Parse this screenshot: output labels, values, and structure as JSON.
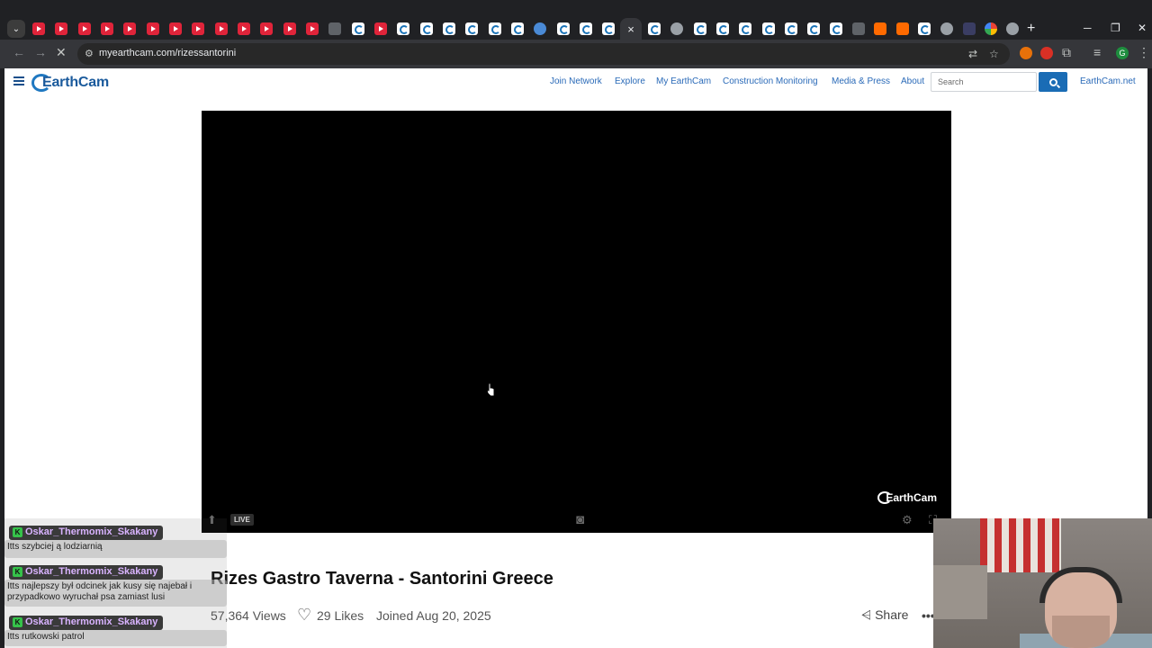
{
  "browser": {
    "active_tab_close": "×",
    "new_tab": "+",
    "url": "myearthcam.com/rizessantorini",
    "profile_initial": "G"
  },
  "site": {
    "logo": "EarthCam",
    "nav": [
      "Join Network",
      "Explore",
      "My EarthCam",
      "Construction Monitoring",
      "Media & Press",
      "About"
    ],
    "search_placeholder": "Search",
    "earthcam_net": "EarthCam.net"
  },
  "player": {
    "watermark": "EarthCam",
    "live_label": "LIVE"
  },
  "camera": {
    "title": "Rizes Gastro Taverna - Santorini Greece",
    "views": "57,364 Views",
    "likes": "29 Likes",
    "joined": "Joined Aug 20, 2025",
    "share": "Share"
  },
  "chat": [
    {
      "user": "Oskar_Thermomix_Skakany",
      "message": "Itts szybciej ą lodziarnią"
    },
    {
      "user": "Oskar_Thermomix_Skakany",
      "message": "Itts najlepszy był odcinek jak kusy się najebał i przypadkowo wyruchał psa zamiast lusi"
    },
    {
      "user": "Oskar_Thermomix_Skakany",
      "message": "Itts rutkowski patrol"
    }
  ],
  "chat_badge": "K",
  "colors": {
    "brand_blue": "#1a6cb5",
    "nav_link": "#2a6ab8",
    "chat_name": "#d9b3ff",
    "youtube_red": "#e0243a"
  }
}
